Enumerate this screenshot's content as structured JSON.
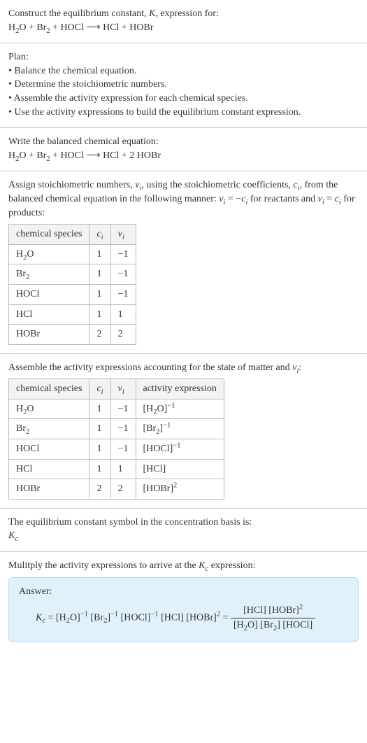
{
  "section1": {
    "title_prefix": "Construct the equilibrium constant, ",
    "title_k": "K",
    "title_suffix": ", expression for:",
    "eq_lhs1": "H",
    "eq_lhs1_sub": "2",
    "eq_lhs1b": "O + Br",
    "eq_lhs1b_sub": "2",
    "eq_lhs1c": " + HOCl",
    "arrow": " ⟶ ",
    "eq_rhs": "HCl + HOBr"
  },
  "plan": {
    "heading": "Plan:",
    "b1": "• Balance the chemical equation.",
    "b2": "• Determine the stoichiometric numbers.",
    "b3": "• Assemble the activity expression for each chemical species.",
    "b4": "• Use the activity expressions to build the equilibrium constant expression."
  },
  "balanced": {
    "heading": "Write the balanced chemical equation:",
    "lhs1": "H",
    "lhs1_sub": "2",
    "lhs1b": "O + Br",
    "lhs1b_sub": "2",
    "lhs1c": " + HOCl",
    "arrow": " ⟶ ",
    "rhs": "HCl + 2 HOBr"
  },
  "stoich": {
    "heading_a": "Assign stoichiometric numbers, ",
    "heading_nu": "ν",
    "heading_isub": "i",
    "heading_b": ", using the stoichiometric coefficients, ",
    "heading_c": "c",
    "heading_b2": ", from the balanced chemical equation in the following manner: ",
    "rel1": " = −",
    "rel2": " for reactants and ",
    "rel3": " = ",
    "rel4": " for products:",
    "col1": "chemical species",
    "col2c": "c",
    "col2i": "i",
    "col3n": "ν",
    "col3i": "i"
  },
  "chart_data": {
    "type": "table",
    "stoich_table": {
      "columns": [
        "chemical species",
        "c_i",
        "ν_i"
      ],
      "rows": [
        {
          "species_a": "H",
          "species_sub": "2",
          "species_b": "O",
          "c": "1",
          "nu": "−1"
        },
        {
          "species_a": "Br",
          "species_sub": "2",
          "species_b": "",
          "c": "1",
          "nu": "−1"
        },
        {
          "species_a": "HOCl",
          "species_sub": "",
          "species_b": "",
          "c": "1",
          "nu": "−1"
        },
        {
          "species_a": "HCl",
          "species_sub": "",
          "species_b": "",
          "c": "1",
          "nu": "1"
        },
        {
          "species_a": "HOBr",
          "species_sub": "",
          "species_b": "",
          "c": "2",
          "nu": "2"
        }
      ]
    },
    "activity_table": {
      "columns": [
        "chemical species",
        "c_i",
        "ν_i",
        "activity expression"
      ],
      "rows": [
        {
          "species_a": "H",
          "species_sub": "2",
          "species_b": "O",
          "c": "1",
          "nu": "−1",
          "act_a": "[H",
          "act_sub": "2",
          "act_b": "O]",
          "act_sup": "−1"
        },
        {
          "species_a": "Br",
          "species_sub": "2",
          "species_b": "",
          "c": "1",
          "nu": "−1",
          "act_a": "[Br",
          "act_sub": "2",
          "act_b": "]",
          "act_sup": "−1"
        },
        {
          "species_a": "HOCl",
          "species_sub": "",
          "species_b": "",
          "c": "1",
          "nu": "−1",
          "act_a": "[HOCl]",
          "act_sub": "",
          "act_b": "",
          "act_sup": "−1"
        },
        {
          "species_a": "HCl",
          "species_sub": "",
          "species_b": "",
          "c": "1",
          "nu": "1",
          "act_a": "[HCl]",
          "act_sub": "",
          "act_b": "",
          "act_sup": ""
        },
        {
          "species_a": "HOBr",
          "species_sub": "",
          "species_b": "",
          "c": "2",
          "nu": "2",
          "act_a": "[HOBr]",
          "act_sub": "",
          "act_b": "",
          "act_sup": "2"
        }
      ]
    }
  },
  "activity": {
    "heading_a": "Assemble the activity expressions accounting for the state of matter and ",
    "heading_nu": "ν",
    "heading_i": "i",
    "heading_b": ":",
    "col4": "activity expression"
  },
  "basis": {
    "line1": "The equilibrium constant symbol in the concentration basis is:",
    "Kc_k": "K",
    "Kc_c": "c"
  },
  "mult": {
    "heading_a": "Mulitply the activity expressions to arrive at the ",
    "heading_b": " expression:"
  },
  "answer": {
    "label": "Answer:",
    "lhs_k": "K",
    "lhs_c": "c",
    "eq": " = ",
    "t1": "[H",
    "t1sub": "2",
    "t1b": "O]",
    "t1sup": "−1",
    "t2": " [Br",
    "t2sub": "2",
    "t2b": "]",
    "t2sup": "−1",
    "t3": " [HOCl]",
    "t3sup": "−1",
    "t4": " [HCl] [HOBr]",
    "t4sup": "2",
    "eq2": " = ",
    "num_a": "[HCl] [HOBr]",
    "num_sup": "2",
    "den_a": "[H",
    "den_sub1": "2",
    "den_b": "O] [Br",
    "den_sub2": "2",
    "den_c": "] [HOCl]"
  }
}
